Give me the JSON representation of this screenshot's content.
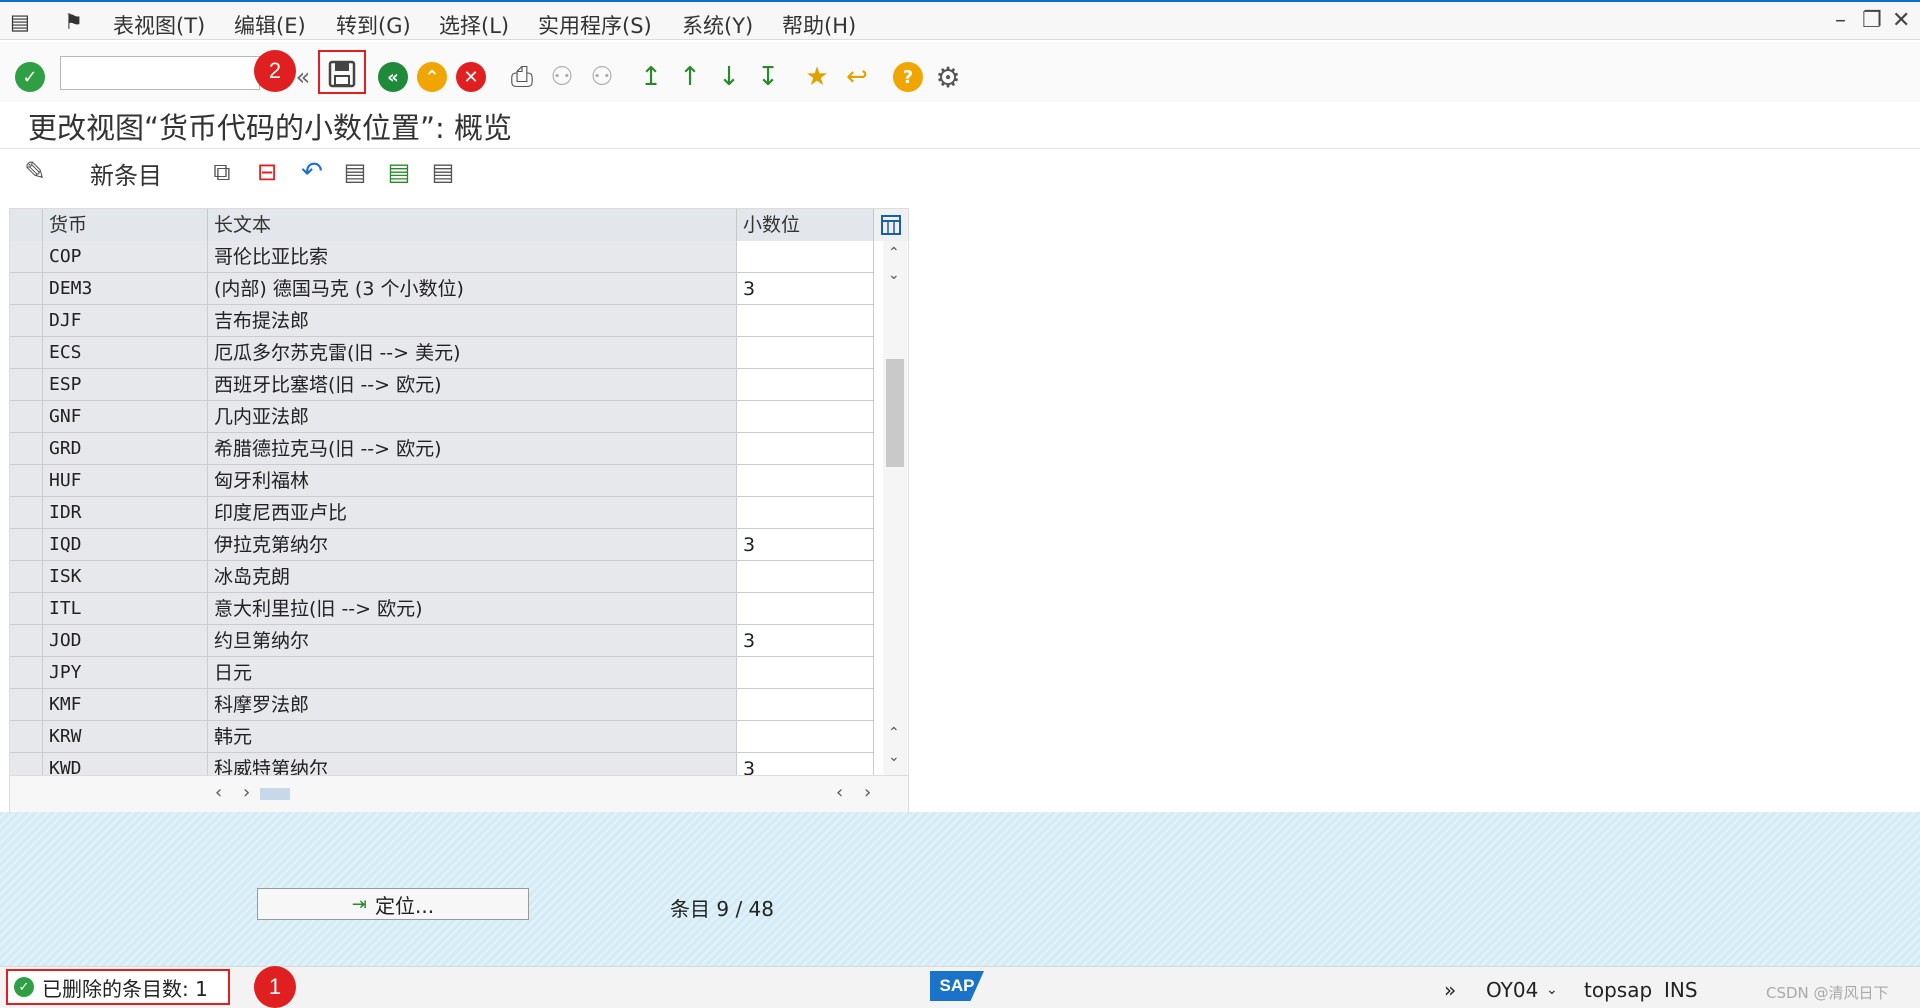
{
  "menu": {
    "items": [
      "表视图(T)",
      "编辑(E)",
      "转到(G)",
      "选择(L)",
      "实用程序(S)",
      "系统(Y)",
      "帮助(H)"
    ]
  },
  "toolbar": {
    "command_value": "",
    "icons": [
      "enter-icon",
      "back-double-icon",
      "save-icon",
      "back-icon",
      "exit-icon",
      "cancel-icon",
      "print-icon",
      "find-icon",
      "find-next-icon",
      "first-page-icon",
      "previous-page-icon",
      "next-page-icon",
      "last-page-icon",
      "create-session-icon",
      "shortcut-icon",
      "help-icon",
      "settings-icon"
    ]
  },
  "annotations": {
    "badge_1": "1",
    "badge_2": "2"
  },
  "title": "更改视图“货币代码的小数位置”: 概览",
  "app_toolbar": {
    "new_entries": "新条目"
  },
  "table": {
    "headers": {
      "currency": "货币",
      "long_text": "长文本",
      "decimals": "小数位"
    },
    "rows": [
      {
        "code": "COP",
        "text": "哥伦比亚比索",
        "dec": ""
      },
      {
        "code": "DEM3",
        "text": "(内部) 德国马克 (3 个小数位)",
        "dec": "3"
      },
      {
        "code": "DJF",
        "text": "吉布提法郎",
        "dec": ""
      },
      {
        "code": "ECS",
        "text": "厄瓜多尔苏克雷(旧 --> 美元)",
        "dec": ""
      },
      {
        "code": "ESP",
        "text": "西班牙比塞塔(旧 --> 欧元)",
        "dec": ""
      },
      {
        "code": "GNF",
        "text": "几内亚法郎",
        "dec": ""
      },
      {
        "code": "GRD",
        "text": "希腊德拉克马(旧 --> 欧元)",
        "dec": ""
      },
      {
        "code": "HUF",
        "text": "匈牙利福林",
        "dec": ""
      },
      {
        "code": "IDR",
        "text": "印度尼西亚卢比",
        "dec": ""
      },
      {
        "code": "IQD",
        "text": "伊拉克第纳尔",
        "dec": "3"
      },
      {
        "code": "ISK",
        "text": "冰岛克朗",
        "dec": ""
      },
      {
        "code": "ITL",
        "text": "意大利里拉(旧 --> 欧元)",
        "dec": ""
      },
      {
        "code": "JOD",
        "text": "约旦第纳尔",
        "dec": "3"
      },
      {
        "code": "JPY",
        "text": "日元",
        "dec": ""
      },
      {
        "code": "KMF",
        "text": "科摩罗法郎",
        "dec": ""
      },
      {
        "code": "KRW",
        "text": "韩元",
        "dec": ""
      },
      {
        "code": "KWD",
        "text": "科威特第纳尔",
        "dec": "3"
      }
    ]
  },
  "footer": {
    "position_button": "定位...",
    "entry_label": "条目 9 / 48"
  },
  "status": {
    "message": "已删除的条目数: 1",
    "transaction": "OY04",
    "server": "topsap",
    "mode": "INS",
    "watermark": "CSDN @清风日下"
  }
}
